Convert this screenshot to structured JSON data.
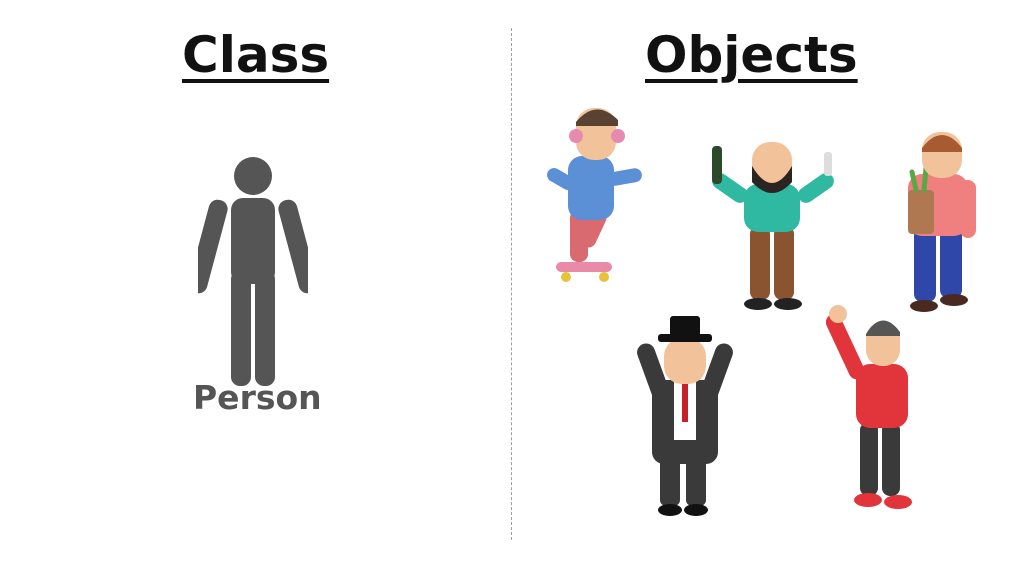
{
  "titles": {
    "class": "Class",
    "objects": "Objects"
  },
  "class_example": {
    "label": "Person"
  },
  "colors": {
    "silhouette": "#555555",
    "divider": "#a0a0a0",
    "skin": "#f2c29b",
    "outline": "#222222"
  },
  "objects": [
    {
      "icon": "skateboarder-with-headphones-icon",
      "shirt": "#5b8fd6",
      "pants": "#d86a70"
    },
    {
      "icon": "bearded-man-with-bottle-icon",
      "shirt": "#2fb8a2",
      "pants": "#8a5430"
    },
    {
      "icon": "man-with-grocery-bag-icon",
      "shirt": "#f07f7f",
      "pants": "#2f47a8"
    },
    {
      "icon": "man-in-top-hat-and-coat-icon",
      "shirt": "#3a3a3a",
      "pants": "#3a3a3a"
    },
    {
      "icon": "waving-man-in-red-sweater-icon",
      "shirt": "#e2353b",
      "pants": "#3a3a3a"
    }
  ]
}
